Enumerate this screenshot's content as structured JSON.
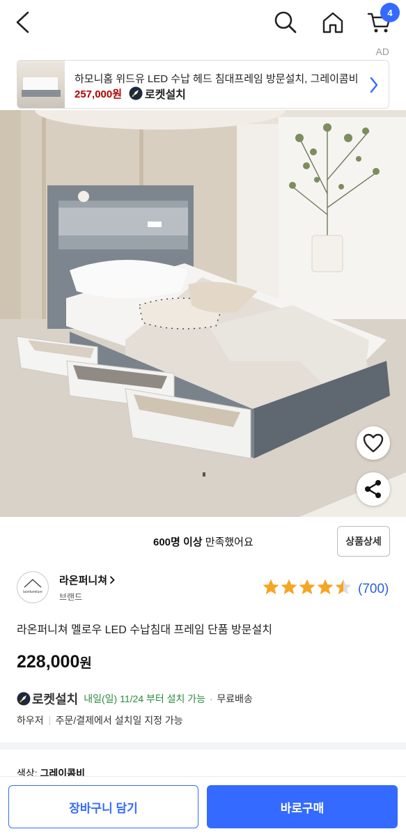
{
  "header": {
    "cart_count": "4",
    "icons": [
      "back-icon",
      "search-icon",
      "home-icon",
      "cart-icon"
    ]
  },
  "ad": {
    "label": "AD",
    "title": "하모니홈 위드유 LED 수납 헤드 침대프레임 방문설치, 그레이콤비",
    "price": "257,000원",
    "rocket_label": "로켓설치"
  },
  "satisfaction": {
    "count": "600명 이상",
    "suffix": " 만족했어요",
    "detail_button": "상품상세"
  },
  "brand": {
    "name": "라온퍼니쳐",
    "sub": "브랜드",
    "logo_text": "laonfurniture"
  },
  "rating": {
    "stars": 4.5,
    "max": 5,
    "count": "(700)"
  },
  "product": {
    "title": "라온퍼니쳐 멜로우 LED 수납침대 프레임 단품 방문설치",
    "price": "228,000",
    "currency": "원"
  },
  "shipping": {
    "rocket_label": "로켓설치",
    "date": "내일(일) 11/24 부터 설치 가능",
    "dot": "·",
    "free": "무료배송",
    "carrier": "하우저",
    "note": "주문/결제에서 설치일 지정 가능"
  },
  "option": {
    "label": "색상:",
    "value": "그레이콤비"
  },
  "actions": {
    "add_to_cart": "장바구니 담기",
    "buy_now": "바로구매"
  },
  "colors": {
    "accent": "#346aff",
    "price_red": "#ae0000",
    "rating_star": "#f5a623",
    "date_green": "#2b8a3e"
  }
}
